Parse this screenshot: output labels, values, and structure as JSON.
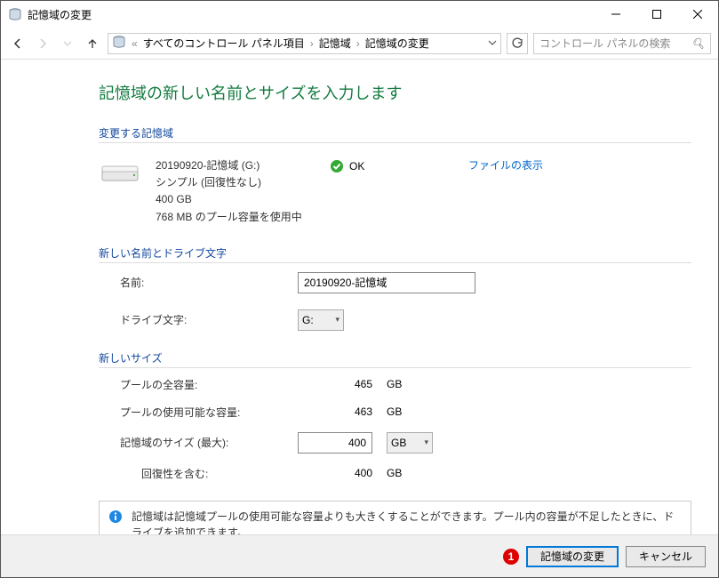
{
  "window": {
    "title": "記憶域の変更"
  },
  "nav": {
    "crumbs": [
      "すべてのコントロール パネル項目",
      "記憶域",
      "記憶域の変更"
    ],
    "search_placeholder": "コントロール パネルの検索"
  },
  "page": {
    "heading": "記憶域の新しい名前とサイズを入力します",
    "section_storage": "変更する記憶域",
    "storage": {
      "name": "20190920-記憶域 (G:)",
      "type": "シンプル (回復性なし)",
      "size": "400 GB",
      "usage": "768 MB のプール容量を使用中",
      "status": "OK",
      "view_files": "ファイルの表示"
    },
    "section_name": "新しい名前とドライブ文字",
    "name_label": "名前:",
    "name_value": "20190920-記憶域",
    "drive_label": "ドライブ文字:",
    "drive_value": "G:",
    "section_size": "新しいサイズ",
    "pool_total_label": "プールの全容量:",
    "pool_total_value": "465",
    "pool_total_unit": "GB",
    "pool_avail_label": "プールの使用可能な容量:",
    "pool_avail_value": "463",
    "pool_avail_unit": "GB",
    "max_size_label": "記憶域のサイズ (最大):",
    "max_size_value": "400",
    "max_size_unit": "GB",
    "resiliency_label": "回復性を含む:",
    "resiliency_value": "400",
    "resiliency_unit": "GB",
    "info": "記憶域は記憶域プールの使用可能な容量よりも大きくすることができます。プール内の容量が不足したときに、ドライブを追加できます。"
  },
  "footer": {
    "badge": "1",
    "apply": "記憶域の変更",
    "cancel": "キャンセル"
  }
}
